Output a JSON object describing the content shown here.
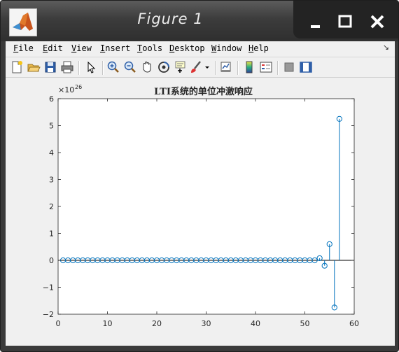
{
  "window": {
    "title": "Figure 1"
  },
  "menu": [
    {
      "key": "F",
      "rest": "ile"
    },
    {
      "key": "E",
      "rest": "dit"
    },
    {
      "key": "V",
      "rest": "iew"
    },
    {
      "key": "I",
      "rest": "nsert"
    },
    {
      "key": "T",
      "rest": "ools"
    },
    {
      "key": "D",
      "rest": "esktop"
    },
    {
      "key": "W",
      "rest": "indow"
    },
    {
      "key": "H",
      "rest": "elp"
    }
  ],
  "dock_arrow": "↘",
  "toolbar_icons": [
    "new-figure-icon",
    "open-file-icon",
    "save-icon",
    "print-icon",
    "pointer-icon",
    "zoom-in-icon",
    "zoom-out-icon",
    "pan-icon",
    "rotate-3d-icon",
    "data-cursor-icon",
    "brush-icon",
    "brush-dropdown-icon",
    "link-plot-icon",
    "colorbar-icon",
    "legend-icon",
    "hide-plot-tools-icon",
    "show-plot-tools-icon"
  ],
  "colors": {
    "stem": "#0072bd",
    "axes_bg": "#ffffff",
    "figure_bg": "#f0f0f0"
  },
  "chart_data": {
    "type": "stem",
    "title": "LTI系统的单位冲激响应",
    "xlabel": "",
    "ylabel": "",
    "y_exponent_label": "×10",
    "y_exponent": "26",
    "xlim": [
      0,
      60
    ],
    "ylim": [
      -2,
      6
    ],
    "xticks": [
      "0",
      "10",
      "20",
      "30",
      "40",
      "50",
      "60"
    ],
    "yticks": [
      "−2",
      "−1",
      "0",
      "1",
      "2",
      "3",
      "4",
      "5",
      "6"
    ],
    "x": [
      1,
      2,
      3,
      4,
      5,
      6,
      7,
      8,
      9,
      10,
      11,
      12,
      13,
      14,
      15,
      16,
      17,
      18,
      19,
      20,
      21,
      22,
      23,
      24,
      25,
      26,
      27,
      28,
      29,
      30,
      31,
      32,
      33,
      34,
      35,
      36,
      37,
      38,
      39,
      40,
      41,
      42,
      43,
      44,
      45,
      46,
      47,
      48,
      49,
      50,
      51,
      52,
      53,
      54,
      55,
      56,
      57
    ],
    "y": [
      0,
      0,
      0,
      0,
      0,
      0,
      0,
      0,
      0,
      0,
      0,
      0,
      0,
      0,
      0,
      0,
      0,
      0,
      0,
      0,
      0,
      0,
      0,
      0,
      0,
      0,
      0,
      0,
      0,
      0,
      0,
      0,
      0,
      0,
      0,
      0,
      0,
      0,
      0,
      0,
      0,
      0,
      0,
      0,
      0,
      0,
      0,
      0,
      0,
      0,
      0,
      0,
      0.08,
      -0.2,
      0.6,
      -1.75,
      5.25
    ]
  }
}
